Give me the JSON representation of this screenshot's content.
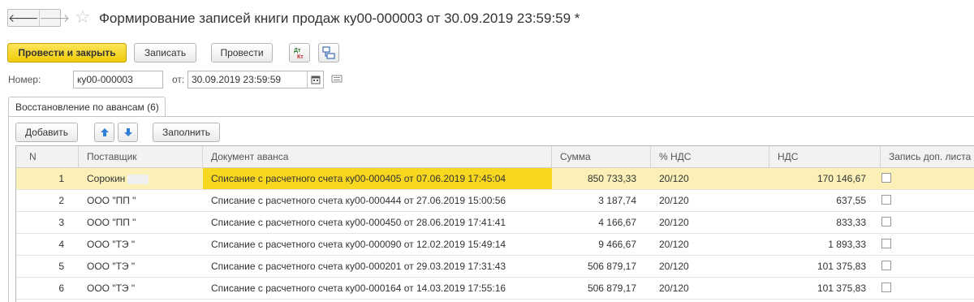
{
  "header": {
    "title": "Формирование записей книги продаж ку00-000003 от 30.09.2019 23:59:59 *",
    "back_glyph": "🡐",
    "forward_glyph": "🡒",
    "star_glyph": "☆"
  },
  "toolbar": {
    "post_close_label": "Провести и закрыть",
    "save_label": "Записать",
    "post_label": "Провести",
    "dt_kt_top": "Дт",
    "dt_kt_bottom": "Кт"
  },
  "form": {
    "number_label": "Номер:",
    "number_value": "ку00-000003",
    "date_label": "от:",
    "date_value": "30.09.2019 23:59:59"
  },
  "tabs": [
    {
      "label": "Восстановление по авансам (6)"
    }
  ],
  "table_toolbar": {
    "add_label": "Добавить",
    "fill_label": "Заполнить"
  },
  "table": {
    "columns": [
      "N",
      "Поставщик",
      "Документ аванса",
      "Сумма",
      "% НДС",
      "НДС",
      "Запись доп. листа"
    ],
    "rows": [
      {
        "n": "1",
        "supplier": "Сорокин",
        "document": "Списание с расчетного счета ку00-000405 от 07.06.2019 17:45:04",
        "sum": "850 733,33",
        "rate": "20/120",
        "vat": "170 146,67",
        "checked": false
      },
      {
        "n": "2",
        "supplier": "ООО \"ПП \"",
        "document": "Списание с расчетного счета ку00-000444 от 27.06.2019 15:00:56",
        "sum": "3 187,74",
        "rate": "20/120",
        "vat": "637,55",
        "checked": false
      },
      {
        "n": "3",
        "supplier": "ООО \"ПП \"",
        "document": "Списание с расчетного счета ку00-000450 от 28.06.2019 17:41:41",
        "sum": "4 166,67",
        "rate": "20/120",
        "vat": "833,33",
        "checked": false
      },
      {
        "n": "4",
        "supplier": "ООО \"ТЭ \"",
        "document": "Списание с расчетного счета ку00-000090 от 12.02.2019 15:49:14",
        "sum": "9 466,67",
        "rate": "20/120",
        "vat": "1 893,33",
        "checked": false
      },
      {
        "n": "5",
        "supplier": "ООО \"ТЭ \"",
        "document": "Списание с расчетного счета ку00-000201 от 29.03.2019 17:31:43",
        "sum": "506 879,17",
        "rate": "20/120",
        "vat": "101 375,83",
        "checked": false
      },
      {
        "n": "6",
        "supplier": "ООО \"ТЭ \"",
        "document": "Списание с расчетного счета ку00-000164 от 14.03.2019 17:55:16",
        "sum": "506 879,17",
        "rate": "20/120",
        "vat": "101 375,83",
        "checked": false
      }
    ]
  },
  "colors": {
    "primary_button": "#f2cb0a",
    "selected_row": "#faf0b8",
    "selected_cell": "#f7d720",
    "arrow_blue": "#2f7fd8"
  }
}
